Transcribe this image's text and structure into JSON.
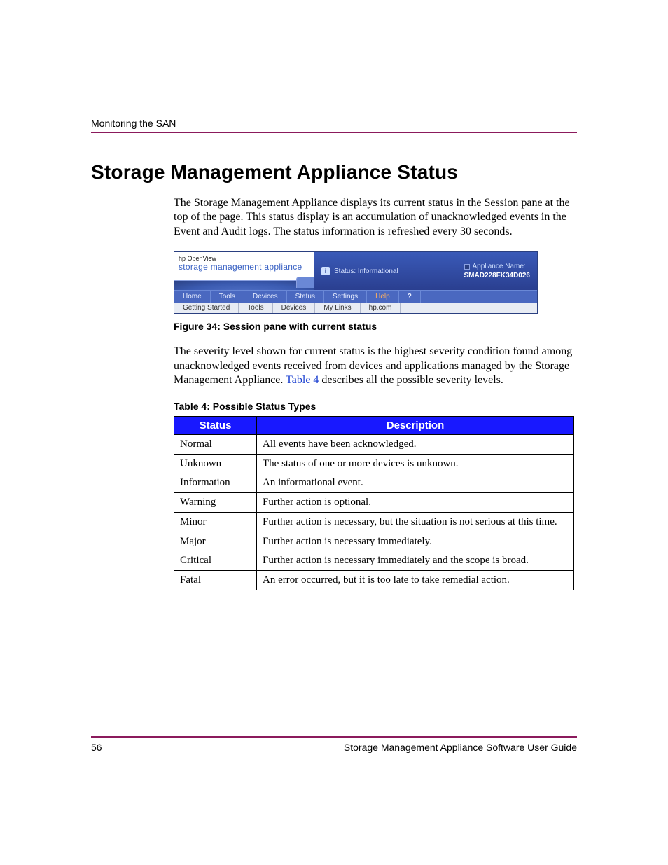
{
  "running_head": "Monitoring the SAN",
  "section_title": "Storage Management Appliance Status",
  "para1": "The Storage Management Appliance displays its current status in the Session pane at the top of the page. This status display is an accumulation of unacknowledged events in the Event and Audit logs. The status information is refreshed every 30 seconds.",
  "figure": {
    "brand_small": "hp OpenView",
    "brand_title": "storage management appliance",
    "status_label": "Status:  Informational",
    "app_label": "Appliance Name:",
    "app_name": "SMAD228FK34D026",
    "tabs": [
      "Home",
      "Tools",
      "Devices",
      "Status",
      "Settings",
      "Help",
      "?"
    ],
    "subtabs": [
      "Getting Started",
      "Tools",
      "Devices",
      "My Links",
      "hp.com"
    ],
    "caption": "Figure 34:  Session pane with current status"
  },
  "para2_pre": "The severity level shown for current status is the highest severity condition found among unacknowledged events received from devices and applications managed by the Storage Management Appliance. ",
  "para2_link": "Table 4",
  "para2_post": " describes all the possible severity levels.",
  "table_caption": "Table 4:  Possible Status Types",
  "table": {
    "headers": {
      "status": "Status",
      "description": "Description"
    },
    "rows": [
      {
        "status": "Normal",
        "description": "All events have been acknowledged."
      },
      {
        "status": "Unknown",
        "description": "The status of one or more devices is unknown."
      },
      {
        "status": "Information",
        "description": "An informational event."
      },
      {
        "status": "Warning",
        "description": "Further action is optional."
      },
      {
        "status": "Minor",
        "description": "Further action is necessary, but the situation is not serious at this time."
      },
      {
        "status": "Major",
        "description": "Further action is necessary immediately."
      },
      {
        "status": "Critical",
        "description": "Further action is necessary immediately and the scope is broad."
      },
      {
        "status": "Fatal",
        "description": "An error occurred, but it is too late to take remedial action."
      }
    ]
  },
  "footer": {
    "page_number": "56",
    "doc_title": "Storage Management Appliance Software User Guide"
  }
}
